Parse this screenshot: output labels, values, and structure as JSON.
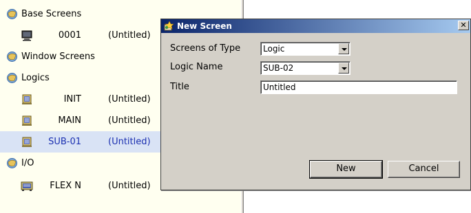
{
  "tree": {
    "sections": [
      {
        "label": "Base Screens",
        "items": [
          {
            "num": "0001",
            "title": "(Untitled)",
            "icon": "monitor-icon"
          }
        ]
      },
      {
        "label": "Window Screens",
        "items": []
      },
      {
        "label": "Logics",
        "items": [
          {
            "num": "INIT",
            "title": "(Untitled)",
            "icon": "logic-icon"
          },
          {
            "num": "MAIN",
            "title": "(Untitled)",
            "icon": "logic-icon"
          },
          {
            "num": "SUB-01",
            "title": "(Untitled)",
            "icon": "logic-icon",
            "selected": true
          }
        ]
      },
      {
        "label": "I/O",
        "items": [
          {
            "num": "FLEX N",
            "title": "(Untitled)",
            "icon": "io-icon"
          }
        ]
      }
    ]
  },
  "dialog": {
    "title": "New Screen",
    "close_glyph": "✕",
    "screens_of_type_label": "Screens of Type",
    "screens_of_type_value": "Logic",
    "logic_name_label": "Logic Name",
    "logic_name_value": "SUB-02",
    "title_label": "Title",
    "title_value": "Untitled",
    "new_button": "New",
    "cancel_button": "Cancel"
  },
  "colors": {
    "tree_background": "#fffff0",
    "selected_row": "#d9e3f5",
    "selected_text": "#1a2fb0",
    "dialog_face": "#d4d0c8",
    "titlebar_start": "#0a246a",
    "titlebar_end": "#a6caf0"
  }
}
